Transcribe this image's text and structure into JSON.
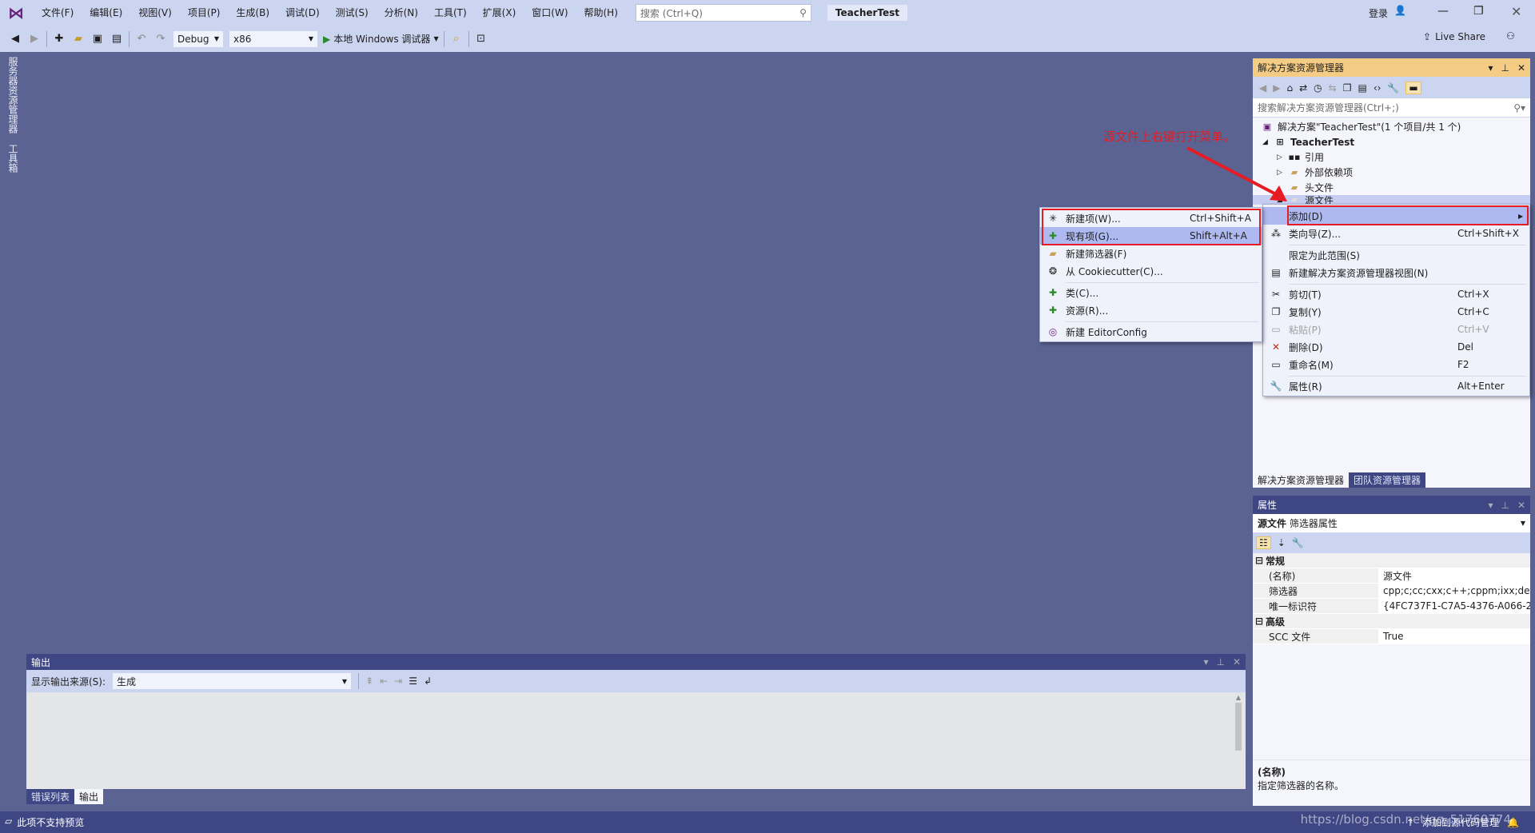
{
  "titlebar": {
    "menus": [
      "文件(F)",
      "编辑(E)",
      "视图(V)",
      "项目(P)",
      "生成(B)",
      "调试(D)",
      "测试(S)",
      "分析(N)",
      "工具(T)",
      "扩展(X)",
      "窗口(W)",
      "帮助(H)"
    ],
    "search_placeholder": "搜索 (Ctrl+Q)",
    "project_title": "TeacherTest",
    "login": "登录"
  },
  "toolbar": {
    "config": "Debug",
    "platform": "x86",
    "run_label": "本地 Windows 调试器",
    "live_share": "Live Share"
  },
  "left_tabs": [
    "服务器资源管理器",
    "工具箱"
  ],
  "solution_explorer": {
    "title": "解决方案资源管理器",
    "search_placeholder": "搜索解决方案资源管理器(Ctrl+;)",
    "tree": [
      {
        "label": "解决方案\"TeacherTest\"(1 个项目/共 1 个)"
      },
      {
        "label": "TeacherTest"
      },
      {
        "label": "引用"
      },
      {
        "label": "外部依赖项"
      },
      {
        "label": "头文件"
      },
      {
        "label": "源文件",
        "selected": true
      }
    ],
    "tabs": [
      "解决方案资源管理器",
      "团队资源管理器"
    ]
  },
  "annotation": "源文件上右键打开菜单。",
  "context_menu": [
    {
      "label": "添加(D)",
      "shortcut": "",
      "icon": "",
      "highlighted": true
    },
    {
      "label": "类向导(Z)...",
      "shortcut": "Ctrl+Shift+X",
      "icon": "class-wizard-icon"
    },
    {
      "label": "限定为此范围(S)",
      "shortcut": "",
      "icon": ""
    },
    {
      "label": "新建解决方案资源管理器视图(N)",
      "shortcut": "",
      "icon": "new-view-icon"
    },
    {
      "label": "剪切(T)",
      "shortcut": "Ctrl+X",
      "icon": "scissors-icon"
    },
    {
      "label": "复制(Y)",
      "shortcut": "Ctrl+C",
      "icon": "copy-icon"
    },
    {
      "label": "粘贴(P)",
      "shortcut": "Ctrl+V",
      "icon": "paste-icon",
      "disabled": true
    },
    {
      "label": "删除(D)",
      "shortcut": "Del",
      "icon": "delete-icon"
    },
    {
      "label": "重命名(M)",
      "shortcut": "F2",
      "icon": "rename-icon"
    },
    {
      "label": "属性(R)",
      "shortcut": "Alt+Enter",
      "icon": "wrench-icon"
    }
  ],
  "submenu": [
    {
      "label": "新建项(W)...",
      "shortcut": "Ctrl+Shift+A"
    },
    {
      "label": "现有项(G)...",
      "shortcut": "Shift+Alt+A",
      "highlighted": true
    },
    {
      "label": "新建筛选器(F)",
      "shortcut": ""
    },
    {
      "label": "从 Cookiecutter(C)...",
      "shortcut": ""
    },
    {
      "label": "类(C)...",
      "shortcut": ""
    },
    {
      "label": "资源(R)...",
      "shortcut": ""
    },
    {
      "label": "新建 EditorConfig",
      "shortcut": ""
    }
  ],
  "properties": {
    "title": "属性",
    "object_name": "源文件",
    "object_type": "筛选器属性",
    "categories": [
      {
        "name": "常规",
        "rows": [
          {
            "name": "(名称)",
            "value": "源文件"
          },
          {
            "name": "筛选器",
            "value": "cpp;c;cc;cxx;c++;cppm;ixx;def;"
          },
          {
            "name": "唯一标识符",
            "value": "{4FC737F1-C7A5-4376-A066-2"
          }
        ]
      },
      {
        "name": "高级",
        "rows": [
          {
            "name": "SCC 文件",
            "value": "True"
          }
        ]
      }
    ],
    "desc_title": "(名称)",
    "desc_text": "指定筛选器的名称。"
  },
  "output": {
    "title": "输出",
    "source_label": "显示输出来源(S):",
    "source_value": "生成",
    "tabs": [
      "错误列表",
      "输出"
    ]
  },
  "status": {
    "left": "此项不支持预览",
    "right": "添加到源代码管理",
    "watermark": "https://blog.csdn.net/qq_51760774"
  },
  "colors": {
    "accent": "#3e4784",
    "highlight": "#aeb9f2",
    "annotation": "#e51c23",
    "active_header": "#f5cc84"
  }
}
